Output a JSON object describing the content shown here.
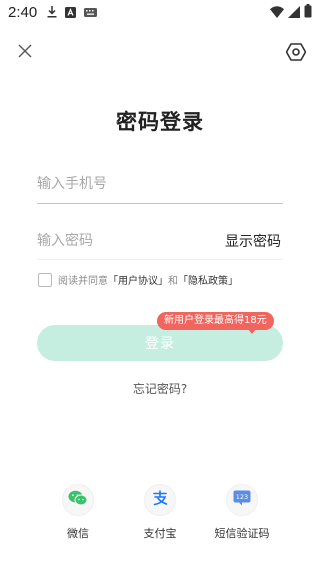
{
  "status_bar": {
    "time": "2:40",
    "icons": [
      "download-icon",
      "a-app-icon",
      "keyboard-icon",
      "wifi-icon",
      "signal-icon",
      "battery-icon"
    ]
  },
  "header": {
    "close_icon": "close-icon",
    "settings_icon": "hexagon-settings-icon"
  },
  "title": "密码登录",
  "form": {
    "phone_placeholder": "输入手机号",
    "password_placeholder": "输入密码",
    "show_password_label": "显示密码"
  },
  "agreement": {
    "prefix": "阅读并同意",
    "user_agreement": "「用户协议」",
    "and": "和",
    "privacy_policy": "「隐私政策」"
  },
  "promo_badge": "新用户登录最高得18元",
  "login_button": "登录",
  "forgot_password": "忘记密码?",
  "third_party": [
    {
      "label": "微信",
      "icon": "wechat-icon"
    },
    {
      "label": "支付宝",
      "icon": "alipay-icon"
    },
    {
      "label": "短信验证码",
      "icon": "sms-code-icon"
    }
  ],
  "colors": {
    "accent_green": "#8fe0c4",
    "login_button_disabled": "#c5eee0",
    "promo_red": "#f0655d",
    "wechat_green": "#3cc070",
    "alipay_blue": "#1677ff"
  }
}
